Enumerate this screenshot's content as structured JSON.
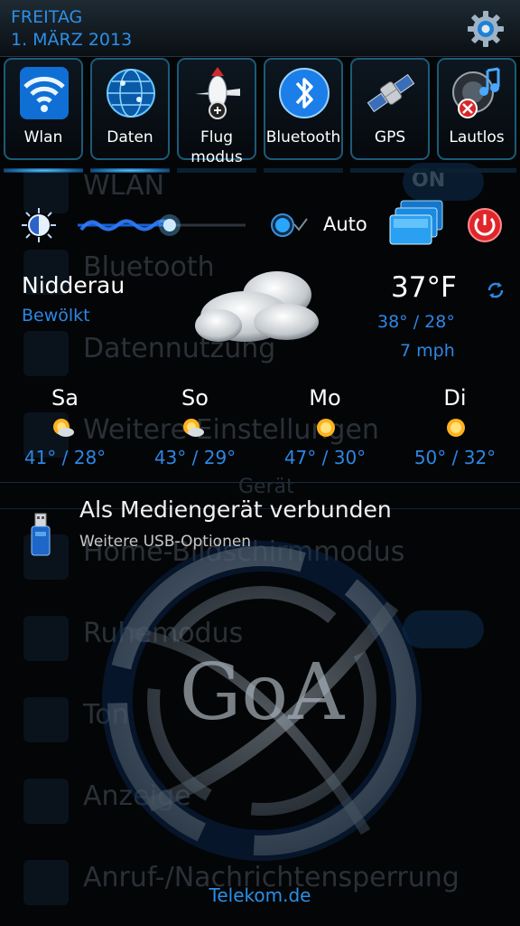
{
  "header": {
    "weekday": "FREITAG",
    "date": "1. MÄRZ 2013",
    "settings_icon": "gear-icon"
  },
  "toggles": [
    {
      "id": "wlan",
      "label": "Wlan",
      "label2": "",
      "icon": "wifi-icon",
      "active": true
    },
    {
      "id": "daten",
      "label": "Daten",
      "label2": "",
      "icon": "globe-network-icon",
      "active": true
    },
    {
      "id": "flug",
      "label": "Flug",
      "label2": "modus",
      "icon": "airplane-icon",
      "active": false
    },
    {
      "id": "bluetooth",
      "label": "Bluetooth",
      "label2": "",
      "icon": "bluetooth-icon",
      "active": false
    },
    {
      "id": "gps",
      "label": "GPS",
      "label2": "",
      "icon": "satellite-icon",
      "active": false
    },
    {
      "id": "lautlos",
      "label": "Lautlos",
      "label2": "",
      "icon": "speaker-muted-icon",
      "active": false
    }
  ],
  "brightness": {
    "auto_label": "Auto",
    "level": 0.55,
    "auto_checked": true
  },
  "weather": {
    "city": "Nidderau",
    "condition": "Bewölkt",
    "temperature": "37°F",
    "hilo": "38° / 28°",
    "wind": "7 mph",
    "forecast": [
      {
        "day": "Sa",
        "temps": "41° / 28°",
        "icon": "partly-cloudy-icon"
      },
      {
        "day": "So",
        "temps": "43° / 29°",
        "icon": "partly-cloudy-icon"
      },
      {
        "day": "Mo",
        "temps": "47° / 30°",
        "icon": "sun-icon"
      },
      {
        "day": "Di",
        "temps": "50° / 32°",
        "icon": "sun-icon"
      }
    ]
  },
  "notification": {
    "title": "Als Mediengerät verbunden",
    "subtitle": "Weitere USB-Optionen",
    "icon": "usb-icon"
  },
  "background": {
    "rows": [
      "WLAN",
      "Bluetooth",
      "Datennutzung",
      "Weitere Einstellungen",
      "Home-Bildschirmmodus",
      "Ruhemodus",
      "Ton",
      "Anzeige",
      "Anruf-/Nachrichtensperrung"
    ],
    "section": "Gerät",
    "toggle_on": "ON",
    "logo_text": "GoA"
  },
  "carrier": "Telekom.de",
  "colors": {
    "accent": "#2d8fe6",
    "tile_border": "#1d5a78",
    "power": "#e0262b"
  }
}
